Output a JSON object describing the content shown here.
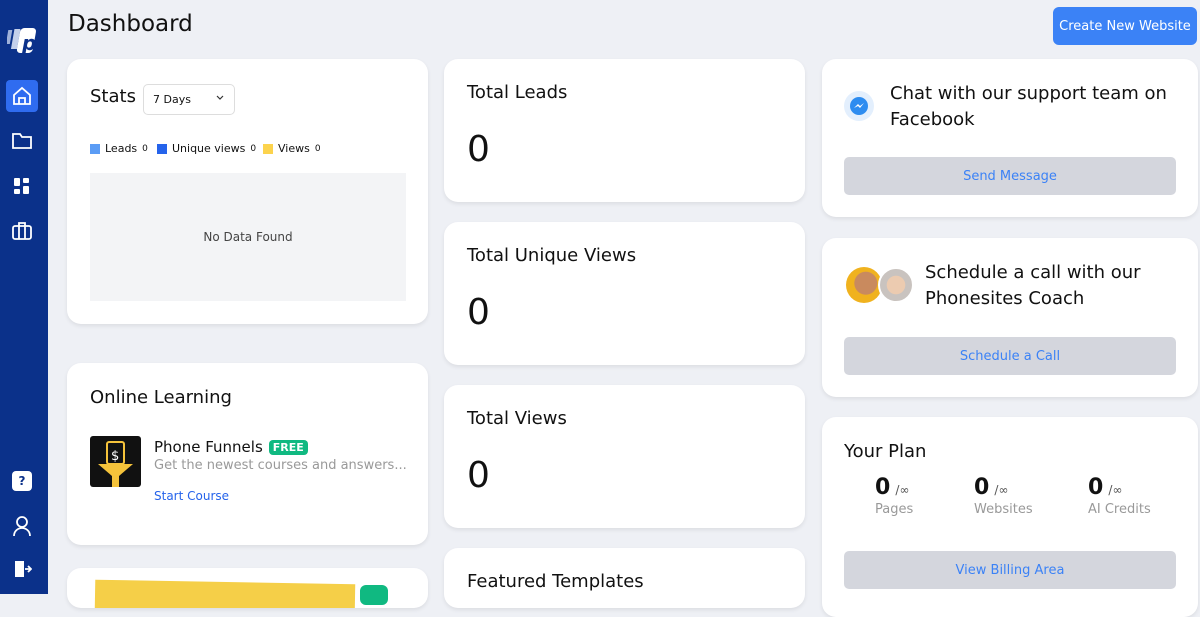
{
  "header": {
    "title": "Dashboard",
    "create_button": "Create New Website"
  },
  "sidebar": {
    "items": [
      "home-icon",
      "folder-icon",
      "apps-icon",
      "briefcase-icon"
    ],
    "bottom": [
      "help-icon",
      "user-icon",
      "logout-icon"
    ],
    "help_glyph": "?"
  },
  "stats": {
    "title": "Stats",
    "range": "7 Days",
    "legend": [
      {
        "label": "Leads",
        "value": "0",
        "color": "#5b9cf5"
      },
      {
        "label": "Unique views",
        "value": "0",
        "color": "#2563eb"
      },
      {
        "label": "Views",
        "value": "0",
        "color": "#fcd34d"
      }
    ],
    "empty": "No Data Found"
  },
  "learning": {
    "title": "Online Learning",
    "course": "Phone Funnels",
    "badge": "FREE",
    "desc": "Get the newest courses and answers...",
    "link": "Start Course"
  },
  "totals": [
    {
      "label": "Total Leads",
      "value": "0"
    },
    {
      "label": "Total Unique Views",
      "value": "0"
    },
    {
      "label": "Total Views",
      "value": "0"
    }
  ],
  "featured": {
    "title": "Featured Templates"
  },
  "support": {
    "text": "Chat with our support team on Facebook",
    "button": "Send Message"
  },
  "coach": {
    "text": "Schedule a call with our Phonesites Coach",
    "button": "Schedule a Call"
  },
  "plan": {
    "title": "Your Plan",
    "items": [
      {
        "value": "0",
        "max": "/∞",
        "label": "Pages"
      },
      {
        "value": "0",
        "max": "/∞",
        "label": "Websites"
      },
      {
        "value": "0",
        "max": "/∞",
        "label": "AI Credits"
      }
    ],
    "button": "View Billing Area"
  }
}
